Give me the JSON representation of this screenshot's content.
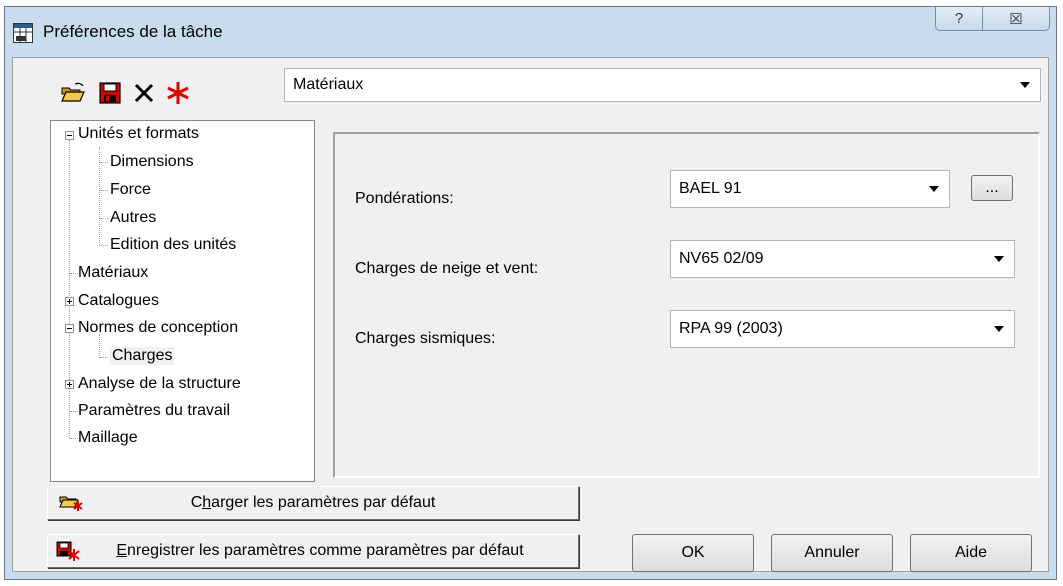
{
  "window": {
    "title": "Préférences de la tâche",
    "help_glyph": "?",
    "close_glyph": "☒"
  },
  "toolbar": {
    "icons": [
      "open-folder-icon",
      "save-disk-icon",
      "delete-x-icon",
      "red-star-icon"
    ]
  },
  "category_select": {
    "value": "Matériaux"
  },
  "tree": {
    "units": "Unités et formats",
    "dimensions": "Dimensions",
    "force": "Force",
    "autres": "Autres",
    "edition": "Edition des unités",
    "materiaux": "Matériaux",
    "catalogues": "Catalogues",
    "normes": "Normes de conception",
    "charges": "Charges",
    "analyse": "Analyse de la structure",
    "parametres": "Paramètres du travail",
    "maillage": "Maillage"
  },
  "form": {
    "ponderations_label": "Pondérations:",
    "ponderations_value": "BAEL 91",
    "browse_label": "...",
    "neige_label": "Charges de neige et vent:",
    "neige_value": "NV65 02/09",
    "sismiques_label": "Charges sismiques:",
    "sismiques_value": "RPA 99 (2003)"
  },
  "buttons": {
    "load_default_prefix": "C",
    "load_default_accel": "h",
    "load_default_rest": "arger les paramètres par défaut",
    "save_default_accel": "E",
    "save_default_rest": "nregistrer les paramètres comme paramètres par défaut",
    "ok": "OK",
    "cancel": "Annuler",
    "help": "Aide"
  },
  "colors": {
    "title_bar": "#c9dced",
    "client_bg": "#f0f0f0",
    "accent_red": "#e00000"
  }
}
